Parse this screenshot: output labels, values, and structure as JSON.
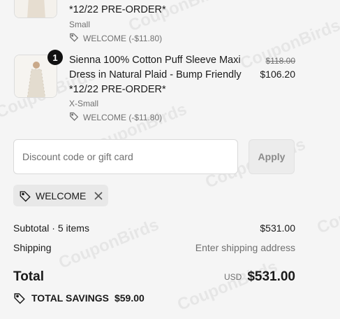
{
  "items": [
    {
      "title_tail": "*12/22 PRE-ORDER*",
      "size": "Small",
      "discount": "WELCOME (-$11.80)"
    },
    {
      "quantity": "1",
      "title": "Sienna 100% Cotton Puff Sleeve Maxi Dress in Natural Plaid - Bump Friendly *12/22 PRE-ORDER*",
      "size": "X-Small",
      "discount": "WELCOME (-$11.80)",
      "original_price": "$118.00",
      "price": "$106.20"
    }
  ],
  "discount_field": {
    "placeholder": "Discount code or gift card",
    "apply_label": "Apply"
  },
  "applied_code": "WELCOME",
  "summary": {
    "subtotal_label": "Subtotal · 5 items",
    "subtotal_value": "$531.00",
    "shipping_label": "Shipping",
    "shipping_value": "Enter shipping address",
    "total_label": "Total",
    "currency": "USD",
    "total_value": "$531.00",
    "savings_label": "TOTAL SAVINGS",
    "savings_value": "$59.00"
  },
  "watermark_text": "CouponBirds"
}
